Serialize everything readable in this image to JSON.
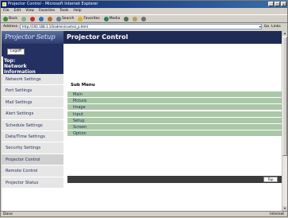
{
  "window": {
    "title": "Projector Control - Microsoft Internet Explorer",
    "controls": [
      "_",
      "□",
      "x"
    ]
  },
  "menubar": [
    "File",
    "Edit",
    "View",
    "Favorites",
    "Tools",
    "Help"
  ],
  "toolbar": {
    "back": "Back",
    "search": "Search",
    "favorites": "Favorites",
    "media": "Media"
  },
  "addressbar": {
    "label": "Address",
    "url": "http://192.168.1.10/admin/control_p.html",
    "go": "Go",
    "links": "Links"
  },
  "page": {
    "logo": "Projector Setup",
    "header_title": "Projector Control",
    "logoff": "Logoff",
    "section_head": "Top:\nNetwork\nInformation",
    "nav": [
      "Network Settings",
      "Port Settings",
      "Mail Settings",
      "Alert Settings",
      "Schedule Settings",
      "Date/Time Settings",
      "Security Settings",
      "Projector Control",
      "Remote Control",
      "Projector Status"
    ],
    "submenu_title": "Sub Menu",
    "submenu": [
      "Main",
      "Picture",
      "Image",
      "Input",
      "Setup",
      "Screen",
      "Option"
    ],
    "top_button": "Top"
  },
  "statusbar": {
    "left": "Done",
    "right": "Internet"
  }
}
